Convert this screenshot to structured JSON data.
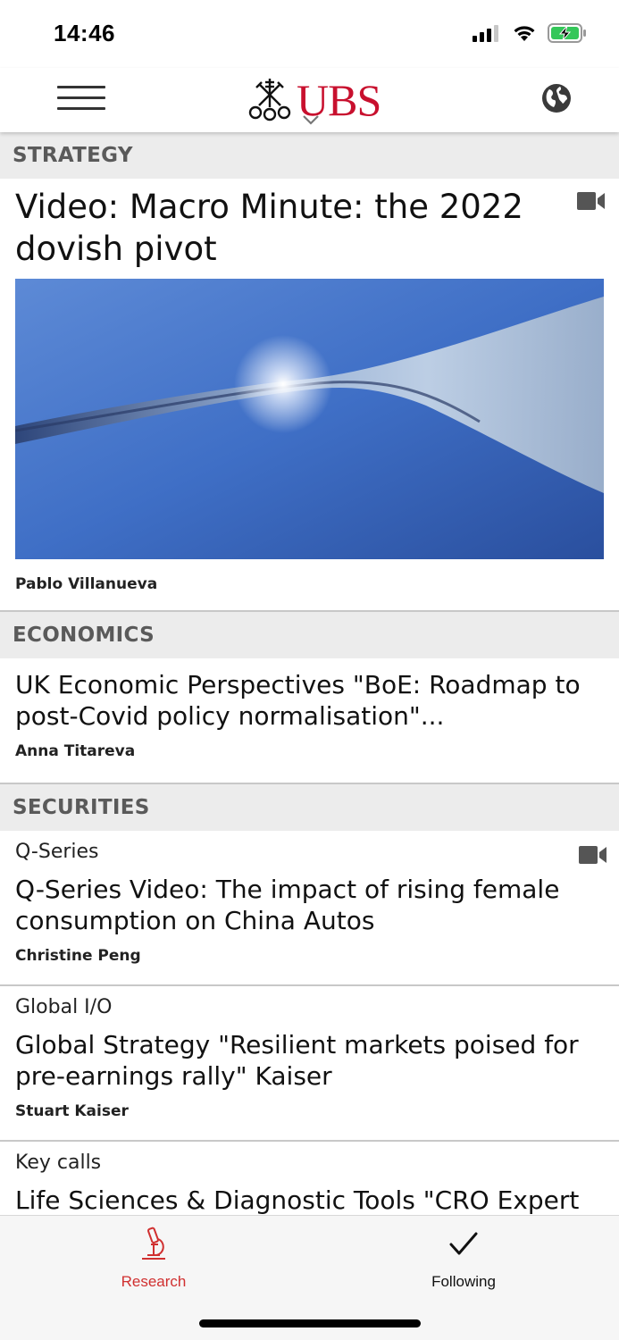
{
  "status_bar": {
    "time": "14:46"
  },
  "header": {
    "logo_text": "UBS",
    "menu_icon": "hamburger-menu-icon",
    "globe_icon": "globe-icon",
    "brand_color": "#c8102e"
  },
  "sections": {
    "strategy": {
      "title": "STRATEGY",
      "article": {
        "title": "Video: Macro Minute: the 2022 dovish pivot",
        "author": "Pablo Villanueva",
        "icon": "video-camera-icon"
      }
    },
    "economics": {
      "title": "ECONOMICS",
      "article": {
        "title": "UK Economic Perspectives \"BoE: Roadmap to post-Covid policy normalisation\"...",
        "author": "Anna Titareva"
      }
    },
    "securities": {
      "title": "SECURITIES",
      "articles": [
        {
          "category": "Q-Series",
          "title": "Q-Series Video: The impact of rising female consumption on China Autos",
          "author": "Christine Peng",
          "icon": "video-camera-icon"
        },
        {
          "category": "Global I/O",
          "title": "Global Strategy \"Resilient markets poised for pre-earnings rally\" Kaiser",
          "author": "Stuart Kaiser"
        },
        {
          "category": "Key calls",
          "title": "Life Sciences & Diagnostic Tools \"CRO Expert"
        }
      ]
    }
  },
  "bottom_nav": {
    "research_label": "Research",
    "following_label": "Following",
    "active_color": "#d03030"
  }
}
